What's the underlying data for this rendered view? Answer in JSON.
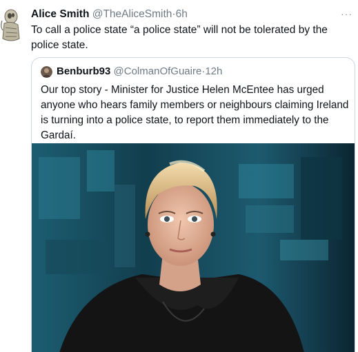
{
  "tweet": {
    "author_name": "Alice Smith",
    "author_handle": "@TheAliceSmith",
    "separator": "·",
    "time": "6h",
    "text": "To call a police state “a police state” will not be tolerated by the police state.",
    "avatar_icon": "ladybird-avatar-icon",
    "more_icon": "more-options-icon",
    "more_label": "···"
  },
  "quoted_tweet": {
    "author_name": "Benburb93",
    "author_handle": "@ColmanOfGuaire",
    "separator": "·",
    "time": "12h",
    "text": "Our top story - Minister for Justice Helen McEntee has urged anyone who hears family members or neighbours  claiming Ireland is turning into a police state, to report them immediately to the Gardaí.",
    "media": {
      "kind": "photo",
      "description_icon": "news-anchor-photo"
    }
  },
  "colors": {
    "text_primary": "#0f1419",
    "text_secondary": "#6e7a85",
    "border": "#cfd9de",
    "background": "#ffffff"
  }
}
